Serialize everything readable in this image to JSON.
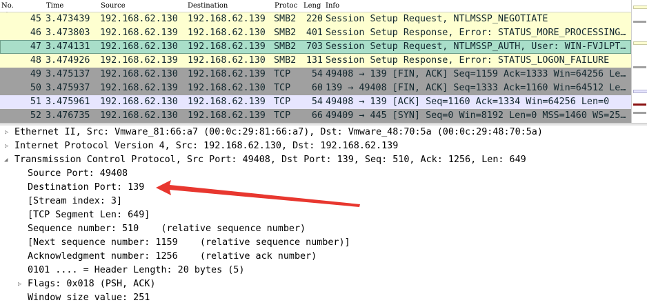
{
  "columns": {
    "no": "No.",
    "time": "Time",
    "source": "Source",
    "destination": "Destination",
    "protocol": "Protoc",
    "length": "Leng",
    "info": "Info"
  },
  "packets": [
    {
      "no": "45",
      "time": "3.473439",
      "src": "192.168.62.130",
      "dst": "192.168.62.139",
      "proto": "SMB2",
      "len": "220",
      "info": "Session Setup Request, NTLMSSP_NEGOTIATE"
    },
    {
      "no": "46",
      "time": "3.473803",
      "src": "192.168.62.139",
      "dst": "192.168.62.130",
      "proto": "SMB2",
      "len": "401",
      "info": "Session Setup Response, Error: STATUS_MORE_PROCESSING…"
    },
    {
      "no": "47",
      "time": "3.474131",
      "src": "192.168.62.130",
      "dst": "192.168.62.139",
      "proto": "SMB2",
      "len": "703",
      "info": "Session Setup Request, NTLMSSP_AUTH, User: WIN-FVJLPT…"
    },
    {
      "no": "48",
      "time": "3.474926",
      "src": "192.168.62.139",
      "dst": "192.168.62.130",
      "proto": "SMB2",
      "len": "131",
      "info": "Session Setup Response, Error: STATUS_LOGON_FAILURE"
    },
    {
      "no": "49",
      "time": "3.475137",
      "src": "192.168.62.130",
      "dst": "192.168.62.139",
      "proto": "TCP",
      "len": "54",
      "info": "49408 → 139 [FIN, ACK] Seq=1159 Ack=1333 Win=64256 Le…"
    },
    {
      "no": "50",
      "time": "3.475937",
      "src": "192.168.62.139",
      "dst": "192.168.62.130",
      "proto": "TCP",
      "len": "60",
      "info": "139 → 49408 [FIN, ACK] Seq=1333 Ack=1160 Win=64512 Le…"
    },
    {
      "no": "51",
      "time": "3.475961",
      "src": "192.168.62.130",
      "dst": "192.168.62.139",
      "proto": "TCP",
      "len": "54",
      "info": "49408 → 139 [ACK] Seq=1160 Ack=1334 Win=64256 Len=0"
    },
    {
      "no": "52",
      "time": "3.476735",
      "src": "192.168.62.130",
      "dst": "192.168.62.139",
      "proto": "TCP",
      "len": "66",
      "info": "49409 → 445 [SYN] Seq=0 Win=8192 Len=0 MSS=1460 WS=25…"
    }
  ],
  "details": {
    "ethernet": "Ethernet II, Src: Vmware_81:66:a7 (00:0c:29:81:66:a7), Dst: Vmware_48:70:5a (00:0c:29:48:70:5a)",
    "ip": "Internet Protocol Version 4, Src: 192.168.62.130, Dst: 192.168.62.139",
    "tcp": "Transmission Control Protocol, Src Port: 49408, Dst Port: 139, Seq: 510, Ack: 1256, Len: 649",
    "src_port": "Source Port: 49408",
    "dst_port": "Destination Port: 139",
    "stream_index": "[Stream index: 3]",
    "segment_len": "[TCP Segment Len: 649]",
    "seq": "Sequence number: 510    (relative sequence number)",
    "next_seq": "[Next sequence number: 1159    (relative sequence number)]",
    "ack": "Acknowledgment number: 1256    (relative ack number)",
    "header_len": "0101 .... = Header Length: 20 bytes (5)",
    "flags": "Flags: 0x018 (PSH, ACK)",
    "window": "Window size value: 251"
  },
  "colors": {
    "smb": "#feffd0",
    "selected": "#a9dec9",
    "tcp_fin": "#a0a0a0",
    "tcp_ack": "#e7e6ff",
    "arrow": "#e8372f"
  },
  "icons": {
    "expand": "triangle-right-icon",
    "collapse": "triangle-down-icon"
  }
}
